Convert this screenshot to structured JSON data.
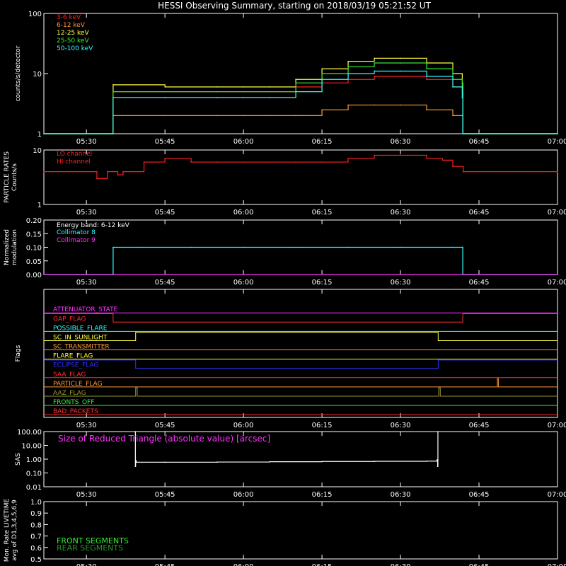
{
  "title": "HESSI Observing Summary, starting on 2018/03/19 05:21:52 UT",
  "time_axis": {
    "start_label": "05:21:52",
    "range_minutes": [
      21.8667,
      120
    ],
    "tick_labels": [
      "05:30",
      "05:45",
      "06:00",
      "06:15",
      "06:30",
      "06:45",
      "07:00"
    ],
    "tick_minutes": [
      30,
      45,
      60,
      75,
      90,
      105,
      120
    ]
  },
  "chart_data": [
    {
      "panel": "lightcurves",
      "type": "line",
      "ylabel": "counts/s/detector",
      "yscale": "log",
      "ylim": [
        1,
        100
      ],
      "ytick_labels": [
        "1",
        "10",
        "100"
      ],
      "series": [
        {
          "name": "3-6 keV",
          "color": "#ff2020",
          "x": [
            21.87,
            35.0,
            35.1,
            45,
            55,
            60,
            65,
            70,
            75,
            80,
            85,
            90,
            95,
            100,
            101.8,
            101.9,
            120
          ],
          "y": [
            1,
            1,
            5,
            5,
            5,
            5,
            5,
            6,
            7,
            8,
            9,
            9,
            8,
            6,
            5,
            1,
            1
          ]
        },
        {
          "name": "6-12 keV",
          "color": "#ff9a33",
          "x": [
            21.87,
            35.0,
            35.1,
            45,
            55,
            60,
            65,
            70,
            75,
            80,
            85,
            90,
            95,
            100,
            101.8,
            101.9,
            120
          ],
          "y": [
            1,
            1,
            2,
            2,
            2,
            2,
            2,
            2,
            2.5,
            3,
            3,
            3,
            2.5,
            2,
            2,
            1,
            1
          ]
        },
        {
          "name": "12-25 keV",
          "color": "#ffff40",
          "x": [
            21.87,
            35.0,
            35.1,
            45,
            55,
            60,
            65,
            70,
            75,
            80,
            85,
            90,
            95,
            100,
            101.8,
            101.9,
            120
          ],
          "y": [
            1,
            1,
            6.5,
            6,
            6,
            6,
            6,
            8,
            12,
            16,
            18,
            18,
            15,
            10,
            7,
            1,
            1
          ]
        },
        {
          "name": "25-50 keV",
          "color": "#33ee33",
          "x": [
            21.87,
            35.0,
            35.1,
            45,
            55,
            60,
            65,
            70,
            75,
            80,
            85,
            90,
            95,
            100,
            101.8,
            101.9,
            120
          ],
          "y": [
            1,
            1,
            5,
            5,
            5,
            5,
            5,
            7,
            10,
            13,
            15,
            15,
            12,
            8,
            6,
            1,
            1
          ]
        },
        {
          "name": "50-100 keV",
          "color": "#33ffff",
          "x": [
            21.87,
            35.0,
            35.1,
            45,
            55,
            60,
            65,
            70,
            75,
            80,
            85,
            90,
            95,
            100,
            101.8,
            101.9,
            120
          ],
          "y": [
            1,
            1,
            4,
            4,
            4,
            4,
            4,
            5,
            8,
            10,
            11,
            11,
            9,
            6,
            4,
            1,
            1
          ]
        }
      ]
    },
    {
      "panel": "particle_rates",
      "type": "line",
      "ylabel": "PARTICLE RATES\nCounts/s",
      "yscale": "log",
      "ylim": [
        1,
        10
      ],
      "ytick_labels": [
        "1",
        "10"
      ],
      "series": [
        {
          "name": "LO channel",
          "color": "#ff2020",
          "x": [
            21.87,
            30,
            32,
            34,
            36,
            37,
            38,
            40,
            41,
            45,
            50,
            55,
            60,
            65,
            70,
            75,
            80,
            85,
            90,
            95,
            98,
            100,
            102,
            105,
            110,
            115,
            120
          ],
          "y": [
            4,
            4,
            3,
            4,
            3.5,
            4,
            4,
            4,
            6,
            7,
            6,
            6,
            6,
            6,
            6,
            6,
            7,
            8,
            8,
            7,
            6.5,
            5,
            4,
            4,
            4,
            4,
            4
          ]
        },
        {
          "name": "HI channel",
          "color": "#ff2020",
          "x": [],
          "y": []
        }
      ]
    },
    {
      "panel": "modulation",
      "type": "line",
      "ylabel": "Normalized\nmodulation",
      "ylim": [
        0,
        0.2
      ],
      "ytick_labels": [
        "0.00",
        "0.05",
        "0.10",
        "0.15",
        "0.20"
      ],
      "annotation": "Energy band: 6-12 keV",
      "series": [
        {
          "name": "Collimator 8",
          "color": "#33ffff",
          "x": [
            21.87,
            35.0,
            35.1,
            40,
            50,
            60,
            70,
            80,
            90,
            100,
            101.8,
            101.9,
            120
          ],
          "y": [
            0,
            0,
            0.1,
            0.1,
            0.1,
            0.1,
            0.1,
            0.1,
            0.1,
            0.1,
            0.1,
            0,
            0
          ]
        },
        {
          "name": "Collimator 9",
          "color": "#ff33ff",
          "x": [
            21.87,
            120
          ],
          "y": [
            0,
            0
          ]
        }
      ]
    },
    {
      "panel": "flags",
      "type": "line",
      "ylabel": "Flags",
      "series": [
        {
          "name": "ATTENUATOR_STATE",
          "color": "#ff33ff",
          "x": [
            21.87,
            120
          ],
          "y": [
            0,
            0
          ]
        },
        {
          "name": "GAP_FLAG",
          "color": "#ff3030",
          "x": [
            21.87,
            35.0,
            35.1,
            101.8,
            101.9,
            120
          ],
          "y": [
            1,
            1,
            0,
            0,
            1,
            1
          ]
        },
        {
          "name": "POSSIBLE_FLARE",
          "color": "#33ffff",
          "x": [
            21.87,
            120
          ],
          "y": [
            0,
            0
          ]
        },
        {
          "name": "SC_IN_SUNLIGHT",
          "color": "#ffff40",
          "x": [
            21.87,
            39.3,
            39.4,
            97.1,
            97.2,
            120
          ],
          "y": [
            0,
            0,
            1,
            1,
            0,
            0
          ]
        },
        {
          "name": "SC_TRANSMITTER",
          "color": "#ff9a33",
          "x": [
            21.87,
            120
          ],
          "y": [
            0,
            0
          ]
        },
        {
          "name": "FLARE_FLAG",
          "color": "#ffff40",
          "x": [
            21.87,
            120
          ],
          "y": [
            0,
            0
          ]
        },
        {
          "name": "ECLIPSE_FLAG",
          "color": "#3030ff",
          "x": [
            21.87,
            39.3,
            39.4,
            97.1,
            97.2,
            120
          ],
          "y": [
            1,
            1,
            0,
            0,
            1,
            1
          ]
        },
        {
          "name": "SAA_FLAG",
          "color": "#ff3030",
          "x": [
            21.87,
            120
          ],
          "y": [
            0,
            0
          ]
        },
        {
          "name": "PARTICLE_FLAG",
          "color": "#ff9a33",
          "x": [
            21.87,
            108.4,
            108.5,
            108.6,
            108.7,
            120
          ],
          "y": [
            0,
            0,
            1,
            1,
            0,
            0
          ]
        },
        {
          "name": "AAZ_FLAG",
          "color": "#999933",
          "x": [
            21.87,
            39.3,
            39.4,
            39.6,
            39.7,
            97.2,
            97.3,
            97.5,
            97.6,
            120
          ],
          "y": [
            0,
            0,
            1,
            1,
            0,
            0,
            1,
            1,
            0,
            0
          ]
        },
        {
          "name": "FRONTS_OFF",
          "color": "#33ee33",
          "x": [
            21.87,
            120
          ],
          "y": [
            0,
            0
          ]
        },
        {
          "name": "BAD_PACKETS",
          "color": "#ff3030",
          "x": [
            21.87,
            120
          ],
          "y": [
            0,
            0
          ]
        }
      ]
    },
    {
      "panel": "sas",
      "type": "line",
      "ylabel": "SAS",
      "yscale": "log",
      "ylim": [
        0.01,
        100
      ],
      "ytick_labels": [
        "0.01",
        "0.10",
        "1.00",
        "10.00",
        "100.00"
      ],
      "annotation": "Size of Reduced Triangle (absolute value) [arcsec]",
      "series": [
        {
          "name": "Size of Reduced Triangle",
          "color": "#ffffff",
          "x": [
            39.3,
            39.35,
            39.4,
            39.5,
            45,
            55,
            65,
            75,
            85,
            95,
            97.0,
            97.1,
            97.15
          ],
          "y": [
            100,
            0.3,
            0.8,
            0.6,
            0.6,
            0.62,
            0.65,
            0.68,
            0.7,
            0.72,
            0.9,
            0.3,
            100
          ]
        }
      ]
    },
    {
      "panel": "livetime",
      "type": "line",
      "ylabel": "Mon. Rate LIVETIME\navg of D1,3,4,5,6,9",
      "ylim": [
        0.5,
        1.0
      ],
      "ytick_labels": [
        "0.5",
        "0.6",
        "0.7",
        "0.8",
        "0.9",
        "1.0"
      ],
      "series": [
        {
          "name": "FRONT SEGMENTS",
          "color": "#33ee33",
          "x": [],
          "y": []
        },
        {
          "name": "REAR SEGMENTS",
          "color": "#1f9a1f",
          "x": [],
          "y": []
        }
      ]
    }
  ]
}
